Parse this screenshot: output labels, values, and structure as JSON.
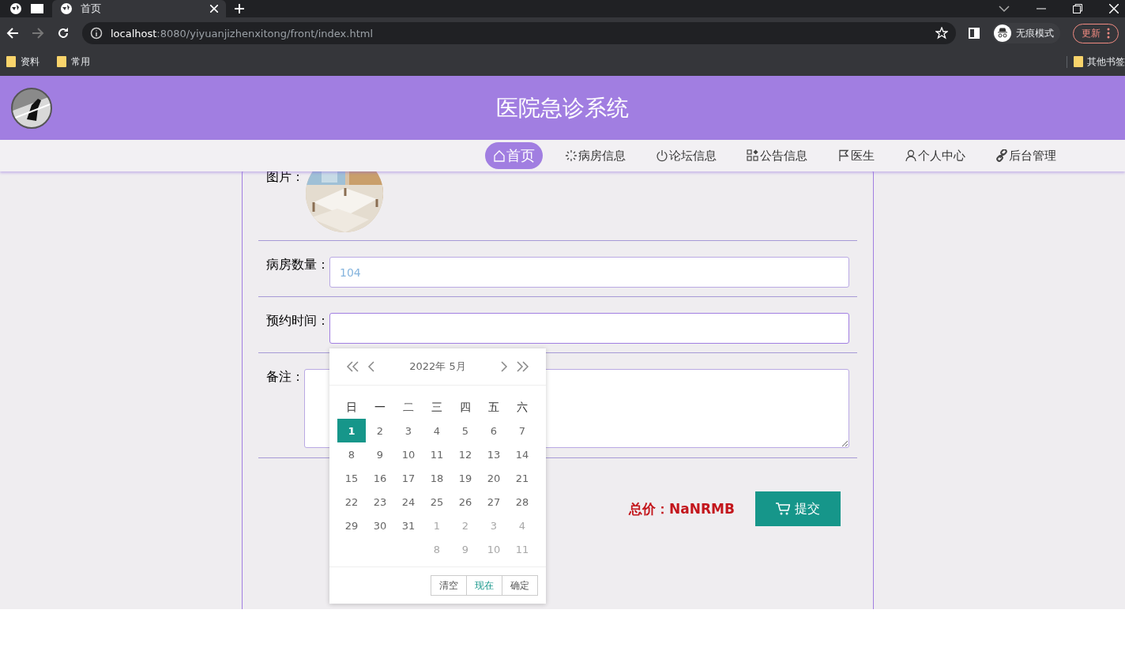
{
  "browser": {
    "tabs": [
      {
        "title": "首页",
        "selected": true
      }
    ],
    "url_host": "localhost",
    "url_path": ":8080/yiyuanjizhenxitong/front/index.html",
    "profile_label": "无痕模式",
    "update_button": "更新",
    "bookmarks": [
      {
        "label": "资料"
      },
      {
        "label": "常用"
      }
    ],
    "other_bookmarks": "其他书签"
  },
  "header": {
    "title": "医院急诊系统"
  },
  "nav": [
    {
      "label": "首页",
      "selected": true
    },
    {
      "label": "病房信息",
      "selected": false
    },
    {
      "label": "论坛信息",
      "selected": false
    },
    {
      "label": "公告信息",
      "selected": false
    },
    {
      "label": "医生",
      "selected": false
    },
    {
      "label": "个人中心",
      "selected": false
    },
    {
      "label": "后台管理",
      "selected": false
    }
  ],
  "form": {
    "fields": [
      {
        "label": "图片：",
        "kind": "picture"
      },
      {
        "label": "病房数量：",
        "kind": "input",
        "value": "104",
        "focused": false
      },
      {
        "label": "预约时间：",
        "kind": "input",
        "focused": true
      },
      {
        "label": "备注：",
        "kind": "textarea"
      }
    ],
    "total": "总价：NaNRMB",
    "submit": "提交"
  },
  "datepicker": {
    "title": "2022年  5月",
    "weekdays": [
      "日",
      "一",
      "二",
      "三",
      "四",
      "五",
      "六"
    ],
    "weeks": [
      [
        {
          "text": "1",
          "muted": false,
          "selected": true
        },
        {
          "text": "2",
          "muted": false,
          "selected": false
        },
        {
          "text": "3",
          "muted": false,
          "selected": false
        },
        {
          "text": "4",
          "muted": false,
          "selected": false
        },
        {
          "text": "5",
          "muted": false,
          "selected": false
        },
        {
          "text": "6",
          "muted": false,
          "selected": false
        },
        {
          "text": "7",
          "muted": false,
          "selected": false
        }
      ],
      [
        {
          "text": "8",
          "muted": false,
          "selected": false
        },
        {
          "text": "9",
          "muted": false,
          "selected": false
        },
        {
          "text": "10",
          "muted": false,
          "selected": false
        },
        {
          "text": "11",
          "muted": false,
          "selected": false
        },
        {
          "text": "12",
          "muted": false,
          "selected": false
        },
        {
          "text": "13",
          "muted": false,
          "selected": false
        },
        {
          "text": "14",
          "muted": false,
          "selected": false
        }
      ],
      [
        {
          "text": "15",
          "muted": false,
          "selected": false
        },
        {
          "text": "16",
          "muted": false,
          "selected": false
        },
        {
          "text": "17",
          "muted": false,
          "selected": false
        },
        {
          "text": "18",
          "muted": false,
          "selected": false
        },
        {
          "text": "19",
          "muted": false,
          "selected": false
        },
        {
          "text": "20",
          "muted": false,
          "selected": false
        },
        {
          "text": "21",
          "muted": false,
          "selected": false
        }
      ],
      [
        {
          "text": "22",
          "muted": false,
          "selected": false
        },
        {
          "text": "23",
          "muted": false,
          "selected": false
        },
        {
          "text": "24",
          "muted": false,
          "selected": false
        },
        {
          "text": "25",
          "muted": false,
          "selected": false
        },
        {
          "text": "26",
          "muted": false,
          "selected": false
        },
        {
          "text": "27",
          "muted": false,
          "selected": false
        },
        {
          "text": "28",
          "muted": false,
          "selected": false
        }
      ],
      [
        {
          "text": "29",
          "muted": false,
          "selected": false
        },
        {
          "text": "30",
          "muted": false,
          "selected": false
        },
        {
          "text": "31",
          "muted": false,
          "selected": false
        },
        {
          "text": "1",
          "muted": true,
          "selected": false
        },
        {
          "text": "2",
          "muted": true,
          "selected": false
        },
        {
          "text": "3",
          "muted": true,
          "selected": false
        },
        {
          "text": "4",
          "muted": true,
          "selected": false
        }
      ],
      [
        {
          "text": "8",
          "muted": true,
          "selected": false
        },
        {
          "text": "9",
          "muted": true,
          "selected": false
        },
        {
          "text": "10",
          "muted": true,
          "selected": false
        },
        {
          "text": "11",
          "muted": true,
          "selected": false
        }
      ]
    ],
    "buttons": [
      {
        "label": "清空",
        "kind": "clear"
      },
      {
        "label": "现在",
        "kind": "now"
      },
      {
        "label": "确定",
        "kind": "confirm"
      }
    ]
  }
}
